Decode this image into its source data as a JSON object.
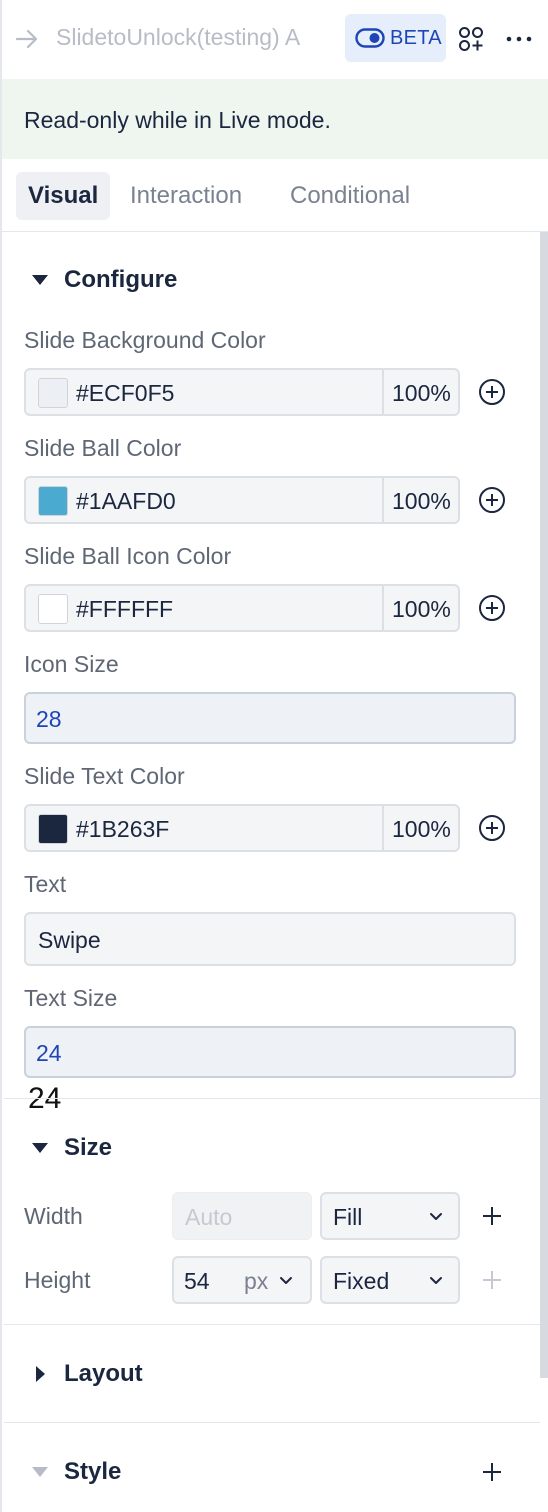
{
  "header": {
    "title": "SlidetoUnlock(testing) A",
    "beta_label": "BETA"
  },
  "banner": {
    "text": "Read-only while in Live mode."
  },
  "tabs": [
    {
      "label": "Visual",
      "active": true
    },
    {
      "label": "Interaction",
      "active": false
    },
    {
      "label": "Conditional",
      "active": false
    }
  ],
  "configure": {
    "title": "Configure",
    "slide_bg": {
      "label": "Slide Background Color",
      "hex": "#ECF0F5",
      "opacity": "100%",
      "swatch": "#ECF0F5"
    },
    "ball_color": {
      "label": "Slide Ball Color",
      "hex": "#1AAFD0",
      "opacity": "100%",
      "swatch": "#4AAAD0"
    },
    "ball_icon_color": {
      "label": "Slide Ball Icon Color",
      "hex": "#FFFFFF",
      "opacity": "100%",
      "swatch": "#FFFFFF"
    },
    "icon_size": {
      "label": "Icon Size",
      "value": "28"
    },
    "text_color": {
      "label": "Slide Text Color",
      "hex": "#1B263F",
      "opacity": "100%",
      "swatch": "#1B263F"
    },
    "text": {
      "label": "Text",
      "value": "Swipe"
    },
    "text_size": {
      "label": "Text Size",
      "value": "24"
    },
    "stray_value": "24"
  },
  "size": {
    "title": "Size",
    "width": {
      "label": "Width",
      "placeholder": "Auto",
      "mode": "Fill"
    },
    "height": {
      "label": "Height",
      "value": "54",
      "unit": "px",
      "mode": "Fixed"
    }
  },
  "layout": {
    "title": "Layout"
  },
  "style": {
    "title": "Style"
  },
  "colors": {
    "accent": "#1D45B8",
    "beta_bg": "#E6EEFB",
    "banner_bg": "#EEF6EF"
  }
}
